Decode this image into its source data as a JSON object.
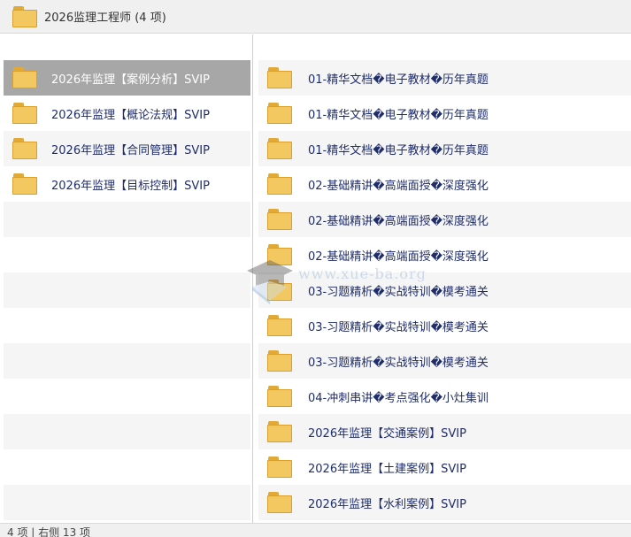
{
  "window": {
    "title": "2026监理工程师 (4 项)"
  },
  "left_pane": {
    "items": [
      {
        "label": "2026年监理【案例分析】SVIP"
      },
      {
        "label": "2026年监理【概论法规】SVIP"
      },
      {
        "label": "2026年监理【合同管理】SVIP"
      },
      {
        "label": "2026年监理【目标控制】SVIP"
      }
    ]
  },
  "right_pane": {
    "items": [
      {
        "label": "01-精华文档�电子教材�历年真题"
      },
      {
        "label": "01-精华文档�电子教材�历年真题"
      },
      {
        "label": "01-精华文档�电子教材�历年真题"
      },
      {
        "label": "02-基础精讲�高端面授�深度强化"
      },
      {
        "label": "02-基础精讲�高端面授�深度强化"
      },
      {
        "label": "02-基础精讲�高端面授�深度强化"
      },
      {
        "label": "03-习题精析�实战特训�模考通关"
      },
      {
        "label": "03-习题精析�实战特训�模考通关"
      },
      {
        "label": "03-习题精析�实战特训�模考通关"
      },
      {
        "label": "04-冲刺串讲�考点强化�小灶集训"
      },
      {
        "label": "2026年监理【交通案例】SVIP"
      },
      {
        "label": "2026年监理【土建案例】SVIP"
      },
      {
        "label": "2026年监理【水利案例】SVIP"
      }
    ]
  },
  "status_bar": {
    "text": "4 项 | 右侧 13 项"
  },
  "watermark": {
    "text": "www.xue-ba.org"
  },
  "colors": {
    "folder": "#f4c860",
    "selected_row": "#a7a7a7",
    "label_text": "#1f2d6b"
  }
}
